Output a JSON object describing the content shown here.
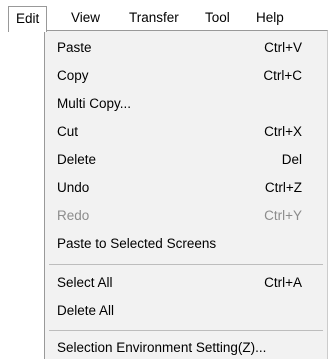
{
  "menubar": {
    "items": [
      {
        "label": "Edit"
      },
      {
        "label": "View"
      },
      {
        "label": "Transfer"
      },
      {
        "label": "Tool"
      },
      {
        "label": "Help"
      }
    ]
  },
  "edit_menu": {
    "items": [
      {
        "label": "Paste",
        "shortcut": "Ctrl+V",
        "enabled": true
      },
      {
        "label": "Copy",
        "shortcut": "Ctrl+C",
        "enabled": true
      },
      {
        "label": "Multi Copy...",
        "shortcut": "",
        "enabled": true
      },
      {
        "label": "Cut",
        "shortcut": "Ctrl+X",
        "enabled": true
      },
      {
        "label": "Delete",
        "shortcut": "Del",
        "enabled": true
      },
      {
        "label": "Undo",
        "shortcut": "Ctrl+Z",
        "enabled": true
      },
      {
        "label": "Redo",
        "shortcut": "Ctrl+Y",
        "enabled": false
      },
      {
        "label": "Paste to Selected Screens",
        "shortcut": "",
        "enabled": true
      },
      {
        "label": "Select All",
        "shortcut": "Ctrl+A",
        "enabled": true
      },
      {
        "label": "Delete All",
        "shortcut": "",
        "enabled": true
      },
      {
        "label": "Selection Environment Setting(Z)...",
        "shortcut": "",
        "enabled": true
      }
    ]
  }
}
